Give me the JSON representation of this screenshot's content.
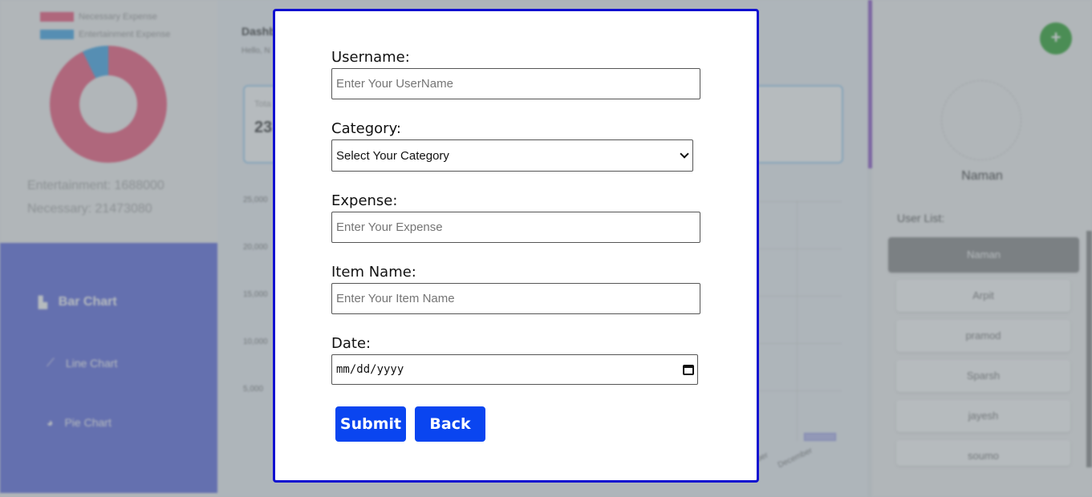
{
  "background": {
    "legend": [
      {
        "label": "Necessary Expense",
        "color": "#f0567a"
      },
      {
        "label": "Entertainment Expense",
        "color": "#3ea5e8"
      }
    ],
    "stats": {
      "entertainment": "Entertainment: 1688000",
      "necessary": "Necessary: 21473080"
    },
    "nav": [
      {
        "label": "Bar Chart",
        "icon": "bar-chart-icon"
      },
      {
        "label": "Line Chart",
        "icon": "line-chart-icon"
      },
      {
        "label": "Pie Chart",
        "icon": "pie-chart-icon"
      }
    ],
    "dashboard_title": "Dashb",
    "dashboard_subtitle": "Hello, N",
    "card_label": "Tota",
    "card_value": "23",
    "y_ticks": [
      "25,000",
      "20,000",
      "15,000",
      "10,000",
      "5,000"
    ],
    "x_labels": [
      "ber",
      "December"
    ],
    "profile_name": "Naman",
    "user_list_title": "User List:",
    "users": [
      "Naman",
      "Arpit",
      "pramod",
      "Sparsh",
      "jayesh",
      "soumo"
    ],
    "add_label": "+"
  },
  "form": {
    "username_label": "Username:",
    "username_placeholder": "Enter Your UserName",
    "category_label": "Category:",
    "category_value": "Select Your Category",
    "expense_label": "Expense:",
    "expense_placeholder": "Enter Your Expense",
    "item_label": "Item Name:",
    "item_placeholder": "Enter Your Item Name",
    "date_label": "Date:",
    "date_value": "mm/dd/yyyy",
    "submit_label": "Submit",
    "back_label": "Back"
  },
  "colors": {
    "modal_border": "#1010d0",
    "button": "#0a45f0",
    "nav": "#5b68e0",
    "add_button": "#29a32c"
  }
}
